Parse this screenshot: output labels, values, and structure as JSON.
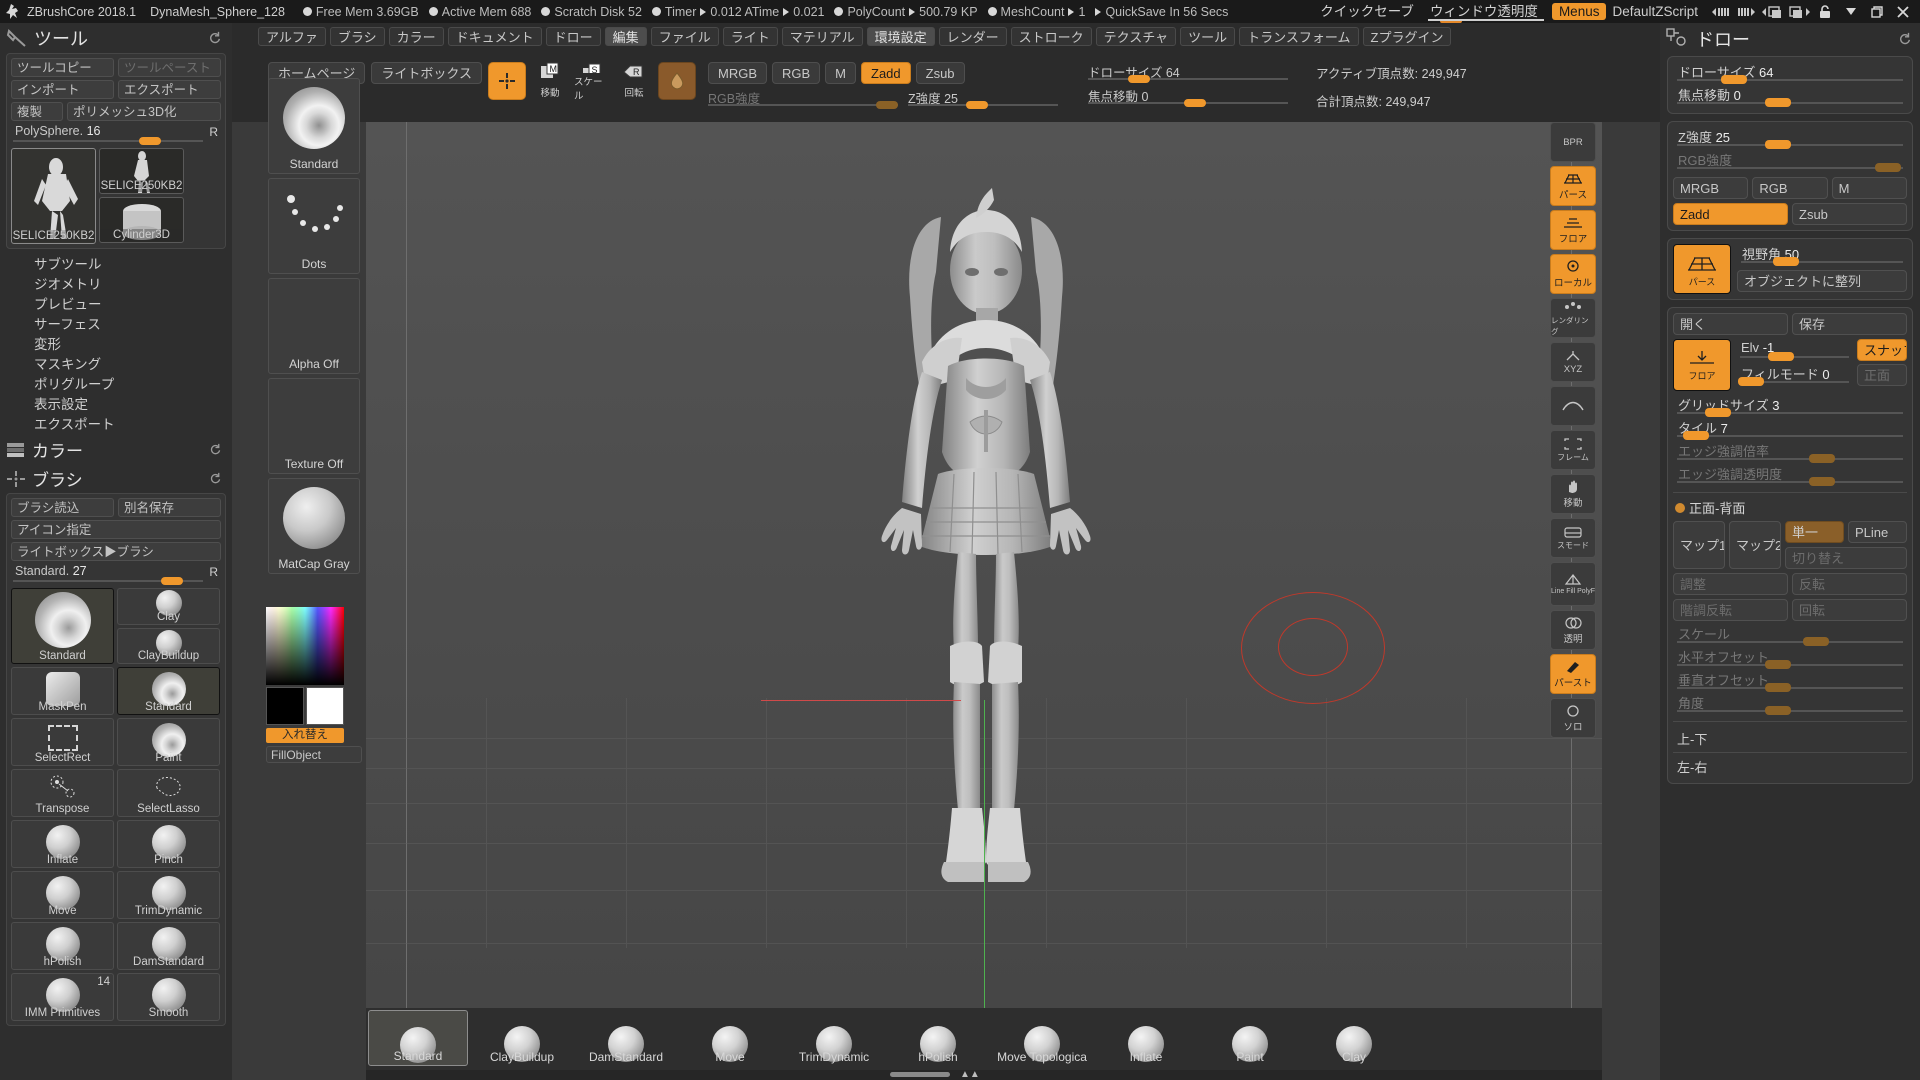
{
  "titlebar": {
    "app_name": "ZBrushCore 2018.1",
    "tool_name": "DynaMesh_Sphere_128",
    "stats": [
      {
        "icon": "circle-icon",
        "label": "Free Mem 3.69GB"
      },
      {
        "icon": "circle-icon",
        "label": "Active Mem 688"
      },
      {
        "icon": "circle-icon",
        "label": "Scratch Disk 52"
      },
      {
        "icon": "circle-icon",
        "label": "Timer",
        "arrow": "▶",
        "value": "0.012 ATime",
        "arrow2": "▶",
        "value2": "0.021"
      },
      {
        "icon": "circle-icon",
        "label": "PolyCount",
        "arrow": "▶",
        "value": "500.79 KP"
      },
      {
        "icon": "circle-icon",
        "label": "MeshCount",
        "arrow": "▶",
        "value": "1"
      },
      {
        "icon": "play-icon",
        "label": "QuickSave In 56 Secs"
      }
    ],
    "quicksave": "クイックセーブ",
    "window_opacity": "ウィンドウ透明度",
    "menus": "Menus",
    "zscript": "DefaultZScript"
  },
  "menubar": {
    "items": [
      "アルファ",
      "ブラシ",
      "カラー",
      "ドキュメント",
      "ドロー",
      "編集",
      "ファイル",
      "ライト",
      "マテリアル",
      "環境設定",
      "レンダー",
      "ストローク",
      "テクスチャ",
      "ツール",
      "トランスフォーム",
      "Zプラグイン"
    ],
    "highlighted": [
      "編集",
      "環境設定"
    ]
  },
  "shelf": {
    "homepage": "ホームページ",
    "lightbox": "ライトボックス",
    "draw_mode": "draw-icon",
    "move": "移動",
    "scale": "スケール",
    "rotate": "回転",
    "mrgb": "MRGB",
    "rgb": "RGB",
    "m": "M",
    "zadd": "Zadd",
    "zsub": "Zsub",
    "rgb_intensity_label": "RGB強度",
    "z_intensity_label": "Z強度",
    "z_intensity_value": "25",
    "draw_size_label": "ドローサイズ",
    "draw_size_value": "64",
    "focal_shift_label": "焦点移動",
    "focal_shift_value": "0",
    "active_points_label": "アクティブ頂点数:",
    "active_points_value": "249,947",
    "total_points_label": "合計頂点数:",
    "total_points_value": "249,947"
  },
  "docstrip": {
    "items": [
      {
        "name": "Standard",
        "kind": "swirl"
      },
      {
        "name": "Dots",
        "kind": "dots"
      },
      {
        "name": "Alpha Off",
        "kind": "empty"
      },
      {
        "name": "Texture Off",
        "kind": "empty"
      },
      {
        "name": "MatCap Gray",
        "kind": "sphere"
      }
    ]
  },
  "tool_palette": {
    "title": "ツール",
    "copy": "ツールコピー",
    "paste": "ツールペースト",
    "import": "インポート",
    "export": "エクスポート",
    "duplicate": "複製",
    "make_polymesh": "ポリメッシュ3D化",
    "slider_label": "PolySphere.",
    "slider_value": "16",
    "slider_r": "R",
    "thumbs": [
      {
        "name": "SELICE250KB2",
        "selected": true
      },
      {
        "name": "SELICE250KB2",
        "selected": false
      },
      {
        "name": "Cylinder3D",
        "selected": false
      }
    ],
    "subitems": [
      "サブツール",
      "ジオメトリ",
      "プレビュー",
      "サーフェス",
      "変形",
      "マスキング",
      "ポリグループ",
      "表示設定",
      "エクスポート"
    ]
  },
  "color_section": {
    "title": "カラー",
    "swap_label": "入れ替え",
    "fill_object": "FillObject"
  },
  "brush_section": {
    "title": "ブラシ",
    "load": "ブラシ読込",
    "save_as": "別名保存",
    "icon_assign": "アイコン指定",
    "lightbox_brush": "ライトボックス▶ブラシ",
    "slider_label": "Standard.",
    "slider_value": "27",
    "slider_r": "R",
    "brushes": [
      {
        "name": "Standard",
        "kind": "swirl",
        "big": true,
        "selected": true
      },
      {
        "name": "Clay",
        "kind": "sphere",
        "big": false,
        "selected": false
      },
      {
        "name": "ClayBuildup",
        "kind": "sphere",
        "big": false,
        "selected": false
      },
      {
        "name": "MaskPen",
        "kind": "sphere",
        "big": false,
        "selected": false
      },
      {
        "name": "Standard",
        "kind": "swirl",
        "big": false,
        "selected": true
      },
      {
        "name": "SelectRect",
        "kind": "dashrect",
        "big": false,
        "selected": false
      },
      {
        "name": "Paint",
        "kind": "swirl",
        "big": false,
        "selected": false
      },
      {
        "name": "Transpose",
        "kind": "target",
        "big": false,
        "selected": false
      },
      {
        "name": "SelectLasso",
        "kind": "lasso",
        "big": false,
        "selected": false
      },
      {
        "name": "Inflate",
        "kind": "sphere",
        "big": false,
        "selected": false
      },
      {
        "name": "Pinch",
        "kind": "sphere",
        "big": false,
        "selected": false
      },
      {
        "name": "Move",
        "kind": "sphere",
        "big": false,
        "selected": false
      },
      {
        "name": "TrimDynamic",
        "kind": "sphere",
        "big": false,
        "selected": false
      },
      {
        "name": "hPolish",
        "kind": "sphere",
        "big": false,
        "selected": false
      },
      {
        "name": "DamStandard",
        "kind": "sphere",
        "big": false,
        "selected": false
      },
      {
        "name": "IMM Primitives",
        "kind": "sphere",
        "big": false,
        "selected": false,
        "count": "14"
      },
      {
        "name": "Smooth",
        "kind": "sphere",
        "big": false,
        "selected": false
      }
    ]
  },
  "canvas": {
    "side_icons": [
      {
        "name": "bpr-button",
        "label": "BPR",
        "active": false
      },
      {
        "name": "perspective-button",
        "label": "パース",
        "active": true
      },
      {
        "name": "floor-button",
        "label": "フロア",
        "active": true
      },
      {
        "name": "local-button",
        "label": "ローカル",
        "active": true
      },
      {
        "name": "edit-dots-button",
        "label": "レンダリング",
        "active": false
      },
      {
        "name": "xyz-button",
        "label": "XYZ",
        "active": false
      },
      {
        "name": "curve-button",
        "label": "",
        "active": false
      },
      {
        "name": "frame-button",
        "label": "フレーム",
        "active": false
      },
      {
        "name": "move-button",
        "label": "移動",
        "active": false
      },
      {
        "name": "smode-button",
        "label": "スモード",
        "active": false
      },
      {
        "name": "polyframe-button",
        "label": "Line Fill PolyF",
        "active": false
      },
      {
        "name": "transparency-button",
        "label": "透明",
        "active": false
      },
      {
        "name": "persp-active-button",
        "label": "パースト",
        "active": true
      },
      {
        "name": "solo-button",
        "label": "ソロ",
        "active": false
      }
    ]
  },
  "bottom_brushes": {
    "items": [
      {
        "name": "Standard",
        "selected": true
      },
      {
        "name": "ClayBuildup",
        "selected": false
      },
      {
        "name": "DamStandard",
        "selected": false
      },
      {
        "name": "Move",
        "selected": false
      },
      {
        "name": "TrimDynamic",
        "selected": false
      },
      {
        "name": "hPolish",
        "selected": false
      },
      {
        "name": "Move Topologica",
        "selected": false
      },
      {
        "name": "Inflate",
        "selected": false
      },
      {
        "name": "Paint",
        "selected": false
      },
      {
        "name": "Clay",
        "selected": false
      }
    ]
  },
  "right_panel": {
    "title": "ドロー",
    "draw_size_label": "ドローサイズ",
    "draw_size_value": "64",
    "focal_shift_label": "焦点移動",
    "focal_shift_value": "0",
    "z_intensity_label": "Z強度",
    "z_intensity_value": "25",
    "rgb_intensity_label": "RGB強度",
    "mrgb": "MRGB",
    "rgb": "RGB",
    "m": "M",
    "zadd": "Zadd",
    "zsub": "Zsub",
    "persp_label": "パース",
    "fov_label": "視野角",
    "fov_value": "50",
    "align_object": "オブジェクトに整列",
    "open": "開く",
    "save": "保存",
    "floor_label": "フロア",
    "elv_label": "Elv",
    "elv_value": "-1",
    "snap": "スナップ",
    "fill_mode_label": "フィルモード",
    "fill_mode_value": "0",
    "front": "正面",
    "grid_size_label": "グリッドサイズ",
    "grid_size_value": "3",
    "tile_label": "タイル",
    "tile_value": "7",
    "edge_boost_label": "エッジ強調倍率",
    "edge_opacity_label": "エッジ強調透明度",
    "front_back": "正面-背面",
    "map1": "マップ1",
    "map2": "マップ2",
    "single": "単一",
    "pline": "PLine",
    "toggle": "切り替え",
    "adjust": "調整",
    "flip": "反転",
    "tone_invert": "階調反転",
    "rotate": "回転",
    "scale_label": "スケール",
    "h_offset_label": "水平オフセット",
    "v_offset_label": "垂直オフセット",
    "angle_label": "角度",
    "up_down": "上-下",
    "left_right": "左-右"
  },
  "colors": {
    "accent": "#f0982c",
    "panel": "#2e2e2e",
    "group": "#353535",
    "canvas": "#4e4e4e",
    "titlebar": "#1a1a1a"
  }
}
